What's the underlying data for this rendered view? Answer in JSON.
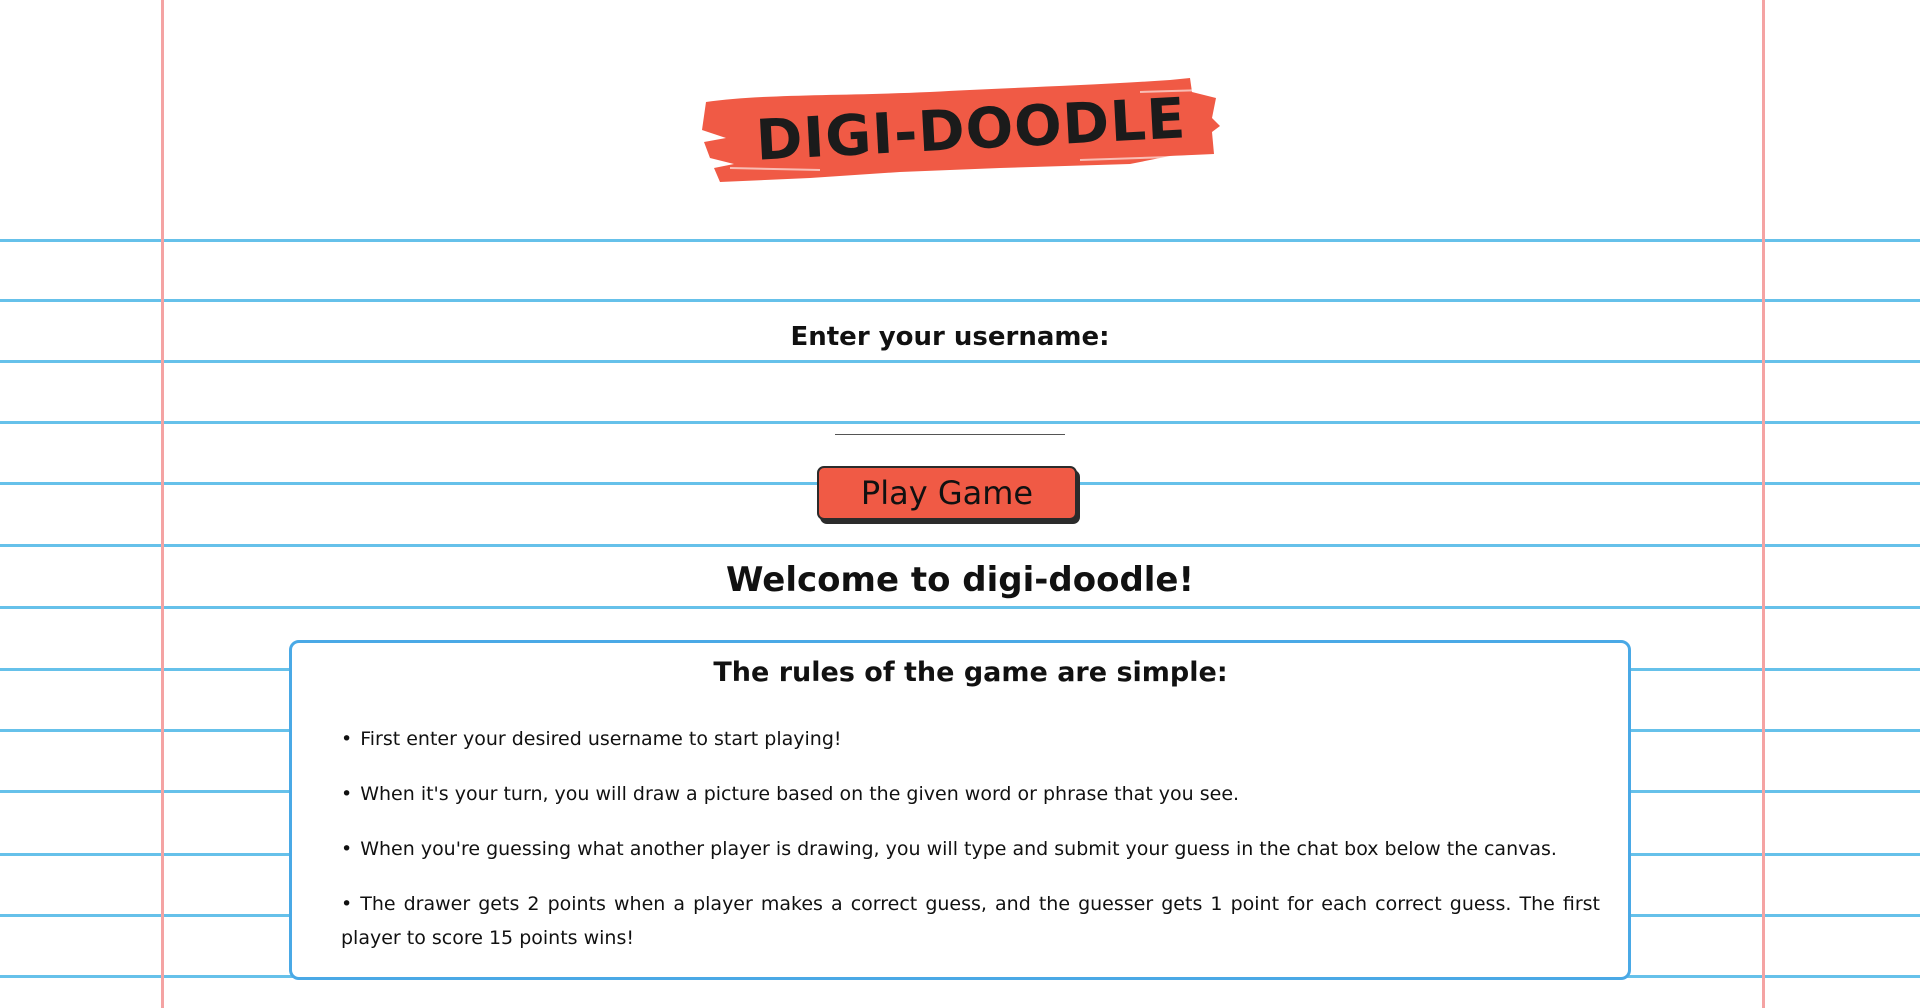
{
  "app": {
    "logo_text": "DIGI-DOODLE",
    "logo_color": "#f05a45"
  },
  "login": {
    "username_label": "Enter your username:",
    "username_value": "",
    "username_placeholder": "",
    "play_button_label": "Play Game",
    "button_color": "#f05a45"
  },
  "welcome": {
    "heading": "Welcome to digi-doodle!"
  },
  "rules": {
    "title": "The rules of the game are simple:",
    "items": [
      "First enter your desired username to start playing!",
      "When it's your turn, you will draw a picture based on the given word or phrase that you see.",
      "When you're guessing what another player is drawing, you will type and submit your guess in the chat box below the canvas.",
      "The drawer gets 2 points when a player makes a correct guess, and the guesser gets 1 point for each correct guess. The first player to score 15 points wins!"
    ],
    "border_color": "#4aa9e6"
  },
  "paper": {
    "rule_color": "#66c1ea",
    "margin_color": "#f4a3a3"
  }
}
